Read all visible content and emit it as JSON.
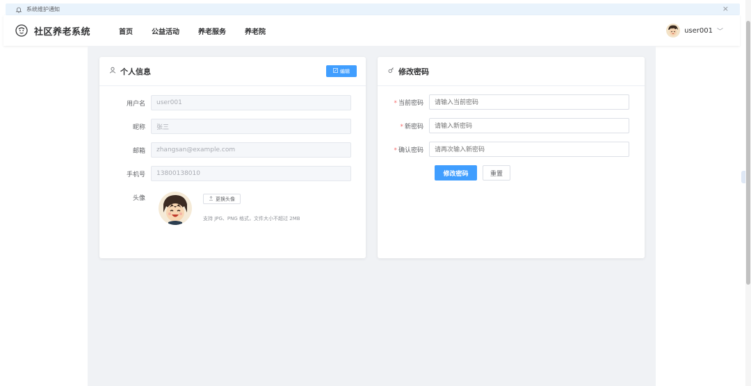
{
  "notice": {
    "text": "系统维护通知",
    "bell_icon": "bell-icon",
    "close_symbol": "×"
  },
  "header": {
    "logo_text": "社区养老系统",
    "nav": [
      "首页",
      "公益活动",
      "养老服务",
      "养老院"
    ],
    "username": "user001",
    "chevron": "﹀"
  },
  "profile_card": {
    "title": "个人信息",
    "edit_label": "编辑",
    "fields": [
      {
        "label": "用户名",
        "value": "user001"
      },
      {
        "label": "昵称",
        "value": "张三"
      },
      {
        "label": "邮箱",
        "value": "zhangsan@example.com"
      },
      {
        "label": "手机号",
        "value": "13800138010"
      }
    ],
    "avatar_label": "头像",
    "upload_label": "更换头像",
    "upload_hint": "支持 JPG、PNG 格式，文件大小不超过 2MB"
  },
  "password_card": {
    "title": "修改密码",
    "fields": [
      {
        "label": "当前密码",
        "placeholder": "请输入当前密码"
      },
      {
        "label": "新密码",
        "placeholder": "请输入新密码"
      },
      {
        "label": "确认密码",
        "placeholder": "请再次输入新密码"
      }
    ],
    "submit_label": "修改密码",
    "reset_label": "重置"
  },
  "colors": {
    "primary": "#409eff",
    "required": "#f56c6c",
    "notice_bg": "#e9f3fc",
    "main_bg": "#f0f2f5"
  }
}
